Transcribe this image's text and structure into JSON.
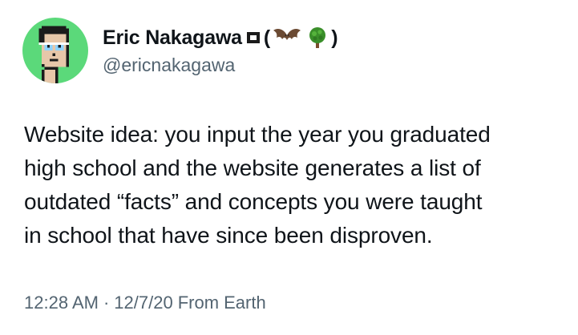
{
  "tweet": {
    "author": {
      "display_name": "Eric Nakagawa",
      "name_suffix_open": "(",
      "name_suffix_close": ")",
      "name_emoji": [
        "square-badge-icon",
        "bat-icon",
        "tree-icon"
      ],
      "handle": "@ericnakagawa",
      "avatar": "pixel-avatar-green-background"
    },
    "text_lines": [
      "Website idea: you input the year you graduated",
      "high school and the website generates a list of",
      "outdated “facts” and concepts you were taught",
      "in school that have since been disproven."
    ],
    "time": "12:28 AM",
    "separator": "·",
    "date": "12/7/20",
    "source": "From Earth"
  },
  "colors": {
    "primary_text": "#0f1419",
    "secondary_text": "#536471",
    "avatar_bg": "#5bd97a"
  }
}
